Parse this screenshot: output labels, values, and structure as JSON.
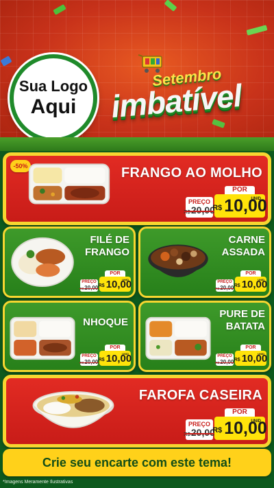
{
  "header": {
    "logo_line1": "Sua Logo",
    "logo_line2": "Aqui",
    "promo_sub": "Setembro",
    "promo_main": "imbatível"
  },
  "colors": {
    "red": "#e22b23",
    "green": "#3e9a2a",
    "yellow": "#ffe30a",
    "dark_green": "#0d5a1e"
  },
  "labels": {
    "old_label": "PREÇO",
    "old_currency": "R$",
    "por": "POR",
    "currency": "R$",
    "unid": "UNID"
  },
  "products": [
    {
      "name": "FRANGO AO MOLHO",
      "old_price": "20,00",
      "price": "10,00",
      "badge": "-50%",
      "icon": "compartment-tray-icon"
    },
    {
      "name_line1": "FILÉ DE",
      "name_line2": "FRANGO",
      "old_price": "20,00",
      "price": "10,00",
      "icon": "round-plate-icon"
    },
    {
      "name_line1": "CARNE",
      "name_line2": "ASSADA",
      "old_price": "20,00",
      "price": "10,00",
      "icon": "bowl-icon"
    },
    {
      "name": "NHOQUE",
      "old_price": "20,00",
      "price": "10,00",
      "icon": "compartment-tray-icon"
    },
    {
      "name_line1": "PURE DE",
      "name_line2": "BATATA",
      "old_price": "20,00",
      "price": "10,00",
      "icon": "compartment-tray-icon"
    },
    {
      "name": "FAROFA CASEIRA",
      "old_price": "20,00",
      "price": "10,00",
      "icon": "bowl-icon"
    }
  ],
  "footer": {
    "cta": "Crie seu encarte com este tema!",
    "disclaimer": "*Imagens Meramente Ilustrativas"
  }
}
